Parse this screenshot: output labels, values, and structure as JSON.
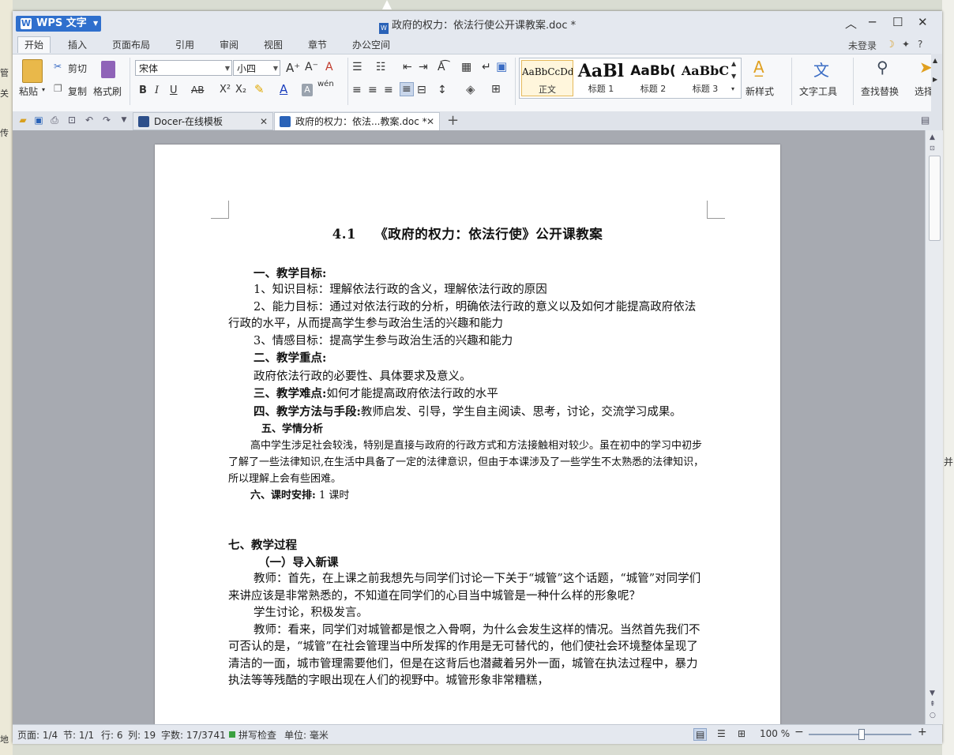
{
  "desktop": {
    "left_labels": [
      "管",
      "关",
      "传",
      "地"
    ],
    "right_labels": [
      "并"
    ]
  },
  "window": {
    "app_button": "WPS 文字",
    "title": "政府的权力：依法行使公开课教案.doc *",
    "controls": {
      "collapse": "︿",
      "minimize": "─",
      "maximize": "☐",
      "close": "✕"
    }
  },
  "menu": {
    "items": [
      "开始",
      "插入",
      "页面布局",
      "引用",
      "审阅",
      "视图",
      "章节",
      "办公空间"
    ],
    "active": "开始",
    "login": "未登录",
    "help": "?"
  },
  "ribbon": {
    "paste": "粘贴",
    "cut": "剪切",
    "copy": "复制",
    "format_painter": "格式刷",
    "font_name": "宋体",
    "font_size": "小四",
    "styles": [
      {
        "preview": "AaBbCcDd",
        "name": "正文"
      },
      {
        "preview": "AaBl",
        "name": "标题 1"
      },
      {
        "preview": "AaBb(",
        "name": "标题 2"
      },
      {
        "preview": "AaBbC",
        "name": "标题 3"
      }
    ],
    "new_style": "新样式",
    "text_tools": "文字工具",
    "find_replace": "查找替换",
    "select": "选择"
  },
  "tabs": [
    {
      "label": "Docer-在线模板",
      "active": false
    },
    {
      "label": "政府的权力：依法...教案.doc *",
      "active": true
    }
  ],
  "document": {
    "heading": "4.1　 《政府的权力：依法行使》公开课教案",
    "s1_title": "一、教学目标:",
    "s1_l1": "1、知识目标：理解依法行政的含义，理解依法行政的原因",
    "s1_l2": "2、能力目标：通过对依法行政的分析，明确依法行政的意义以及如何才能提高政府依法行政的水平，从而提高学生参与政治生活的兴趣和能力",
    "s1_l3": "3、情感目标：提高学生参与政治生活的兴趣和能力",
    "s2_title": "二、教学重点:",
    "s2_body": "政府依法行政的必要性、具体要求及意义。",
    "s3_title": "三、教学难点:",
    "s3_body": "如何才能提高政府依法行政的水平",
    "s4_title": "四、教学方法与手段:",
    "s4_body": "教师启发、引导，学生自主阅读、思考，讨论，交流学习成果。",
    "s5_title": "五、学情分析",
    "s5_body": "高中学生涉足社会较浅，特别是直接与政府的行政方式和方法接触相对较少。虽在初中的学习中初步了解了一些法律知识,在生活中具备了一定的法律意识，但由于本课涉及了一些学生不太熟悉的法律知识，所以理解上会有些困难。",
    "s6_title": "六、课时安排:",
    "s6_body": " 1 课时",
    "s7_title": "七、教学过程",
    "s7_sub": "（一）导入新课",
    "p1": "教师：首先，在上课之前我想先与同学们讨论一下关于“城管”这个话题，“城管”对同学们来讲应该是非常熟悉的，不知道在同学们的心目当中城管是一种什么样的形象呢？",
    "p2": "学生讨论，积极发言。",
    "p3": "教师：看来，同学们对城管都是恨之入骨啊，为什么会发生这样的情况。当然首先我们不可否认的是，“城管”在社会管理当中所发挥的作用是无可替代的，他们使社会环境整体呈现了清洁的一面，城市管理需要他们，但是在这背后也潜藏着另外一面，城管在执法过程中，暴力执法等等残酷的字眼出现在人们的视野中。城管形象非常糟糕，"
  },
  "status": {
    "page": "页面: 1/4",
    "section": "节: 1/1",
    "row": "行: 6",
    "col": "列: 19",
    "words": "字数: 17/3741",
    "spell": "拼写检查",
    "unit": "单位: 毫米",
    "zoom": "100 %"
  }
}
